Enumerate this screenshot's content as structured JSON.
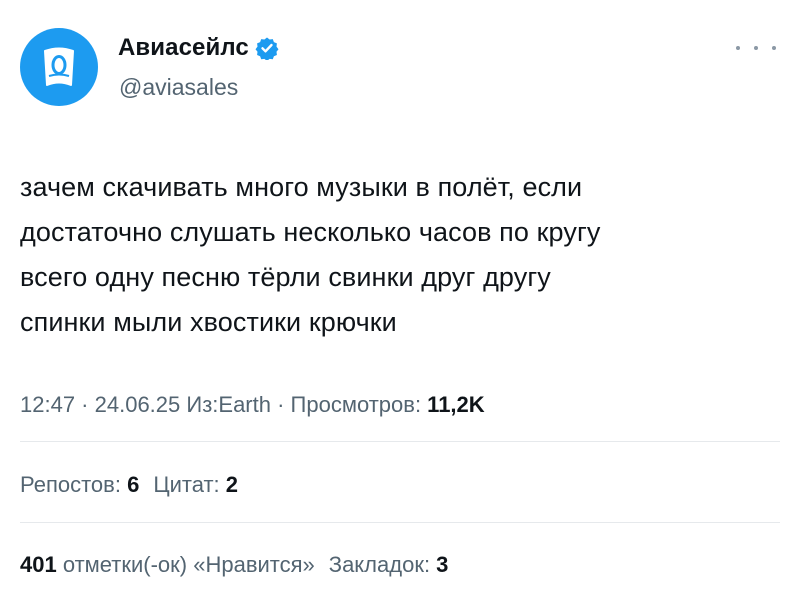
{
  "author": {
    "name": "Авиасейлс",
    "handle": "@aviasales"
  },
  "tweet": {
    "lines": [
      "зачем скачивать много музыки в полёт, если",
      "достаточно слушать несколько часов по кругу",
      "всего одну песню тёрли свинки друг другу",
      "спинки мыли хвостики крючки"
    ]
  },
  "meta": {
    "time": "12:47",
    "sep1": " · ",
    "date": "24.06.25",
    "source": " Из:Earth",
    "sep2": " · ",
    "views_label": "Просмотров: ",
    "views_count": "11,2K"
  },
  "stats": {
    "reposts_label": "Репостов: ",
    "reposts_count": "6",
    "quotes_label": "Цитат: ",
    "quotes_count": "2",
    "likes_count": "401",
    "likes_label": " отметки(-ок) «Нравится»",
    "bookmarks_label": "Закладок: ",
    "bookmarks_count": "3"
  },
  "colors": {
    "brand_blue": "#1d9bf0",
    "text_primary": "#0f1419",
    "text_secondary": "#536471"
  },
  "icons": {
    "avatar": "aviasales-logo-icon",
    "verified": "verified-badge-icon",
    "more": "more-options-icon"
  }
}
